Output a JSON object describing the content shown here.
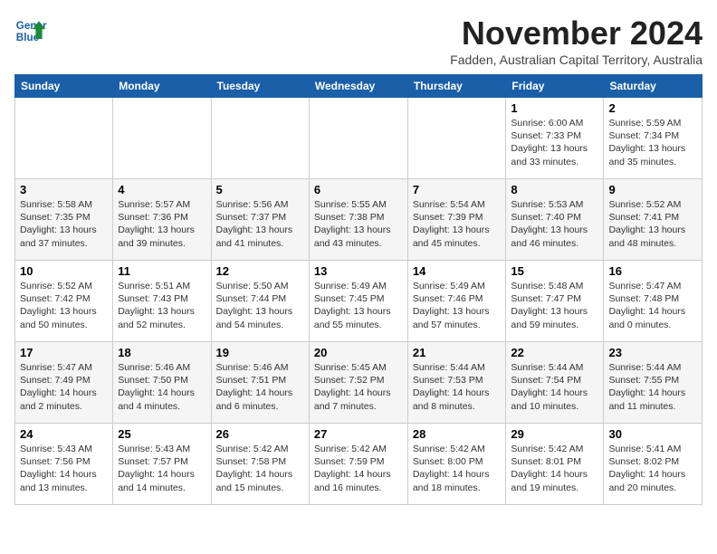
{
  "header": {
    "logo_line1": "General",
    "logo_line2": "Blue",
    "month_title": "November 2024",
    "subtitle": "Fadden, Australian Capital Territory, Australia"
  },
  "days_of_week": [
    "Sunday",
    "Monday",
    "Tuesday",
    "Wednesday",
    "Thursday",
    "Friday",
    "Saturday"
  ],
  "weeks": [
    [
      {
        "day": "",
        "info": ""
      },
      {
        "day": "",
        "info": ""
      },
      {
        "day": "",
        "info": ""
      },
      {
        "day": "",
        "info": ""
      },
      {
        "day": "",
        "info": ""
      },
      {
        "day": "1",
        "info": "Sunrise: 6:00 AM\nSunset: 7:33 PM\nDaylight: 13 hours\nand 33 minutes."
      },
      {
        "day": "2",
        "info": "Sunrise: 5:59 AM\nSunset: 7:34 PM\nDaylight: 13 hours\nand 35 minutes."
      }
    ],
    [
      {
        "day": "3",
        "info": "Sunrise: 5:58 AM\nSunset: 7:35 PM\nDaylight: 13 hours\nand 37 minutes."
      },
      {
        "day": "4",
        "info": "Sunrise: 5:57 AM\nSunset: 7:36 PM\nDaylight: 13 hours\nand 39 minutes."
      },
      {
        "day": "5",
        "info": "Sunrise: 5:56 AM\nSunset: 7:37 PM\nDaylight: 13 hours\nand 41 minutes."
      },
      {
        "day": "6",
        "info": "Sunrise: 5:55 AM\nSunset: 7:38 PM\nDaylight: 13 hours\nand 43 minutes."
      },
      {
        "day": "7",
        "info": "Sunrise: 5:54 AM\nSunset: 7:39 PM\nDaylight: 13 hours\nand 45 minutes."
      },
      {
        "day": "8",
        "info": "Sunrise: 5:53 AM\nSunset: 7:40 PM\nDaylight: 13 hours\nand 46 minutes."
      },
      {
        "day": "9",
        "info": "Sunrise: 5:52 AM\nSunset: 7:41 PM\nDaylight: 13 hours\nand 48 minutes."
      }
    ],
    [
      {
        "day": "10",
        "info": "Sunrise: 5:52 AM\nSunset: 7:42 PM\nDaylight: 13 hours\nand 50 minutes."
      },
      {
        "day": "11",
        "info": "Sunrise: 5:51 AM\nSunset: 7:43 PM\nDaylight: 13 hours\nand 52 minutes."
      },
      {
        "day": "12",
        "info": "Sunrise: 5:50 AM\nSunset: 7:44 PM\nDaylight: 13 hours\nand 54 minutes."
      },
      {
        "day": "13",
        "info": "Sunrise: 5:49 AM\nSunset: 7:45 PM\nDaylight: 13 hours\nand 55 minutes."
      },
      {
        "day": "14",
        "info": "Sunrise: 5:49 AM\nSunset: 7:46 PM\nDaylight: 13 hours\nand 57 minutes."
      },
      {
        "day": "15",
        "info": "Sunrise: 5:48 AM\nSunset: 7:47 PM\nDaylight: 13 hours\nand 59 minutes."
      },
      {
        "day": "16",
        "info": "Sunrise: 5:47 AM\nSunset: 7:48 PM\nDaylight: 14 hours\nand 0 minutes."
      }
    ],
    [
      {
        "day": "17",
        "info": "Sunrise: 5:47 AM\nSunset: 7:49 PM\nDaylight: 14 hours\nand 2 minutes."
      },
      {
        "day": "18",
        "info": "Sunrise: 5:46 AM\nSunset: 7:50 PM\nDaylight: 14 hours\nand 4 minutes."
      },
      {
        "day": "19",
        "info": "Sunrise: 5:46 AM\nSunset: 7:51 PM\nDaylight: 14 hours\nand 6 minutes."
      },
      {
        "day": "20",
        "info": "Sunrise: 5:45 AM\nSunset: 7:52 PM\nDaylight: 14 hours\nand 7 minutes."
      },
      {
        "day": "21",
        "info": "Sunrise: 5:44 AM\nSunset: 7:53 PM\nDaylight: 14 hours\nand 8 minutes."
      },
      {
        "day": "22",
        "info": "Sunrise: 5:44 AM\nSunset: 7:54 PM\nDaylight: 14 hours\nand 10 minutes."
      },
      {
        "day": "23",
        "info": "Sunrise: 5:44 AM\nSunset: 7:55 PM\nDaylight: 14 hours\nand 11 minutes."
      }
    ],
    [
      {
        "day": "24",
        "info": "Sunrise: 5:43 AM\nSunset: 7:56 PM\nDaylight: 14 hours\nand 13 minutes."
      },
      {
        "day": "25",
        "info": "Sunrise: 5:43 AM\nSunset: 7:57 PM\nDaylight: 14 hours\nand 14 minutes."
      },
      {
        "day": "26",
        "info": "Sunrise: 5:42 AM\nSunset: 7:58 PM\nDaylight: 14 hours\nand 15 minutes."
      },
      {
        "day": "27",
        "info": "Sunrise: 5:42 AM\nSunset: 7:59 PM\nDaylight: 14 hours\nand 16 minutes."
      },
      {
        "day": "28",
        "info": "Sunrise: 5:42 AM\nSunset: 8:00 PM\nDaylight: 14 hours\nand 18 minutes."
      },
      {
        "day": "29",
        "info": "Sunrise: 5:42 AM\nSunset: 8:01 PM\nDaylight: 14 hours\nand 19 minutes."
      },
      {
        "day": "30",
        "info": "Sunrise: 5:41 AM\nSunset: 8:02 PM\nDaylight: 14 hours\nand 20 minutes."
      }
    ]
  ]
}
